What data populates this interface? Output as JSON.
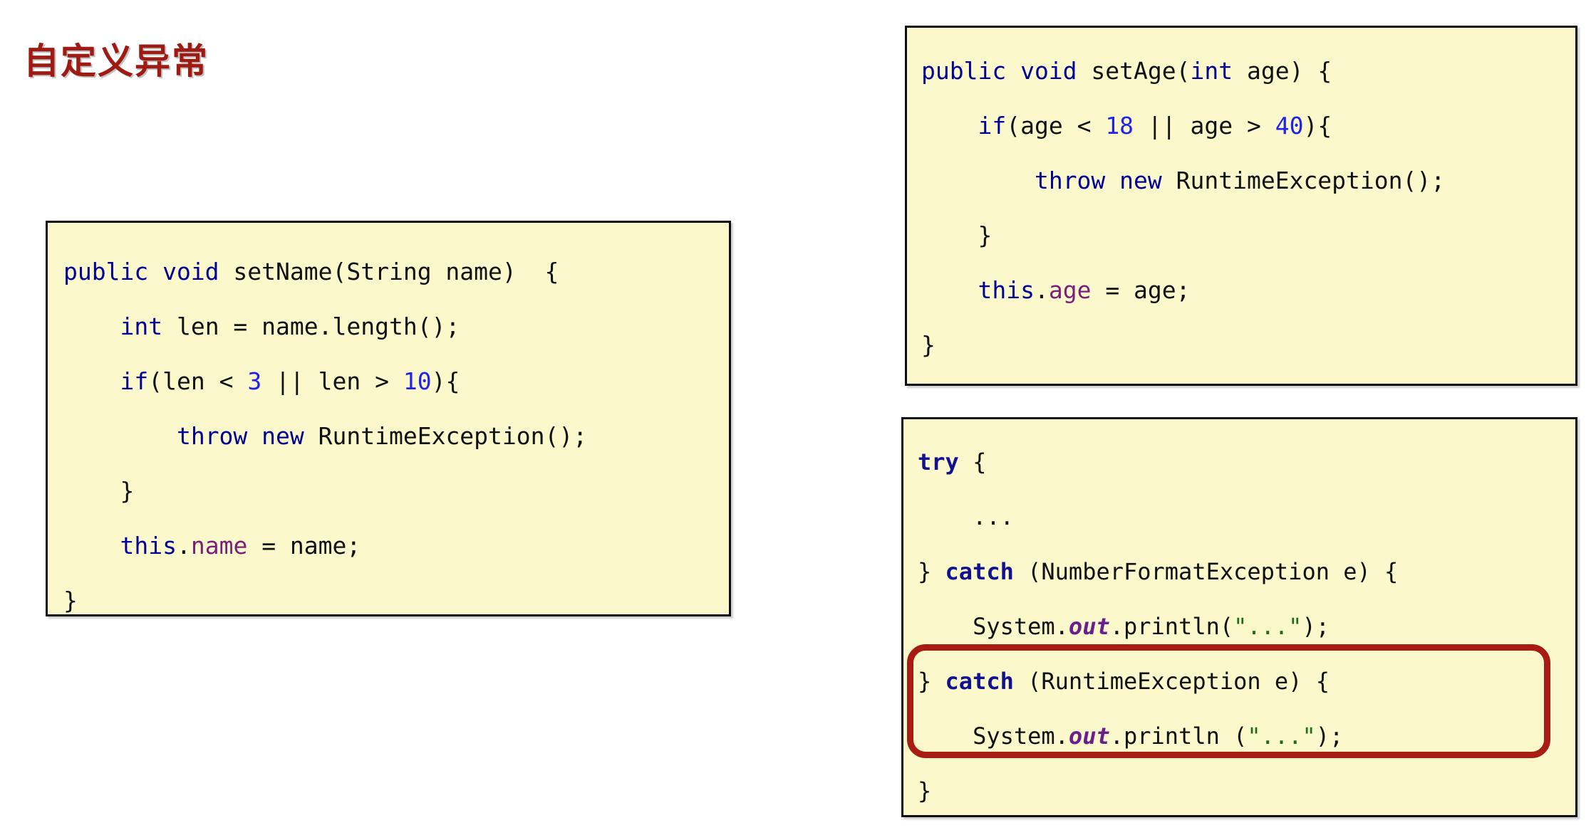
{
  "slide": {
    "title": "自定义异常",
    "title_color": "#9e1b14",
    "background_color": "#ffffff"
  },
  "palette": {
    "code_background": "#fbf8cc",
    "code_border": "#0e0e0e",
    "keyword": "#000099",
    "number": "#2222ee",
    "field": "#7a1f7a",
    "string": "#1d6b1d",
    "plain": "#111111",
    "highlight_ring": "#a81d13"
  },
  "code_blocks": [
    {
      "id": "set-name",
      "language": "java",
      "lines": [
        "public void setName(String name)  {",
        "    int len = name.length();",
        "    if(len < 3 || len > 10){",
        "        throw new RuntimeException();",
        "    }",
        "    this.name = name;",
        "}"
      ],
      "tokens": [
        [
          {
            "t": "public void ",
            "c": "kw"
          },
          {
            "t": "setName(String name)  {",
            "c": "pln"
          }
        ],
        [
          {
            "t": "    ",
            "c": "pln"
          },
          {
            "t": "int",
            "c": "kw"
          },
          {
            "t": " len = name.length();",
            "c": "pln"
          }
        ],
        [
          {
            "t": "    ",
            "c": "pln"
          },
          {
            "t": "if",
            "c": "kw"
          },
          {
            "t": "(len < ",
            "c": "pln"
          },
          {
            "t": "3",
            "c": "num"
          },
          {
            "t": " || len > ",
            "c": "pln"
          },
          {
            "t": "10",
            "c": "num"
          },
          {
            "t": "){",
            "c": "pln"
          }
        ],
        [
          {
            "t": "        ",
            "c": "pln"
          },
          {
            "t": "throw new",
            "c": "kw"
          },
          {
            "t": " RuntimeException();",
            "c": "pln"
          }
        ],
        [
          {
            "t": "    }",
            "c": "pln"
          }
        ],
        [
          {
            "t": "    ",
            "c": "pln"
          },
          {
            "t": "this",
            "c": "kw"
          },
          {
            "t": ".",
            "c": "pln"
          },
          {
            "t": "name",
            "c": "fld"
          },
          {
            "t": " = name;",
            "c": "pln"
          }
        ],
        [
          {
            "t": "}",
            "c": "pln"
          }
        ]
      ]
    },
    {
      "id": "set-age",
      "language": "java",
      "lines": [
        "public void setAge(int age) {",
        "    if(age < 18 || age > 40){",
        "        throw new RuntimeException();",
        "    }",
        "    this.age = age;",
        "}"
      ],
      "tokens": [
        [
          {
            "t": "public void ",
            "c": "kw"
          },
          {
            "t": "setAge(",
            "c": "pln"
          },
          {
            "t": "int",
            "c": "kw"
          },
          {
            "t": " age) {",
            "c": "pln"
          }
        ],
        [
          {
            "t": "    ",
            "c": "pln"
          },
          {
            "t": "if",
            "c": "kw"
          },
          {
            "t": "(age < ",
            "c": "pln"
          },
          {
            "t": "18",
            "c": "num"
          },
          {
            "t": " || age > ",
            "c": "pln"
          },
          {
            "t": "40",
            "c": "num"
          },
          {
            "t": "){",
            "c": "pln"
          }
        ],
        [
          {
            "t": "        ",
            "c": "pln"
          },
          {
            "t": "throw new",
            "c": "kw"
          },
          {
            "t": " RuntimeException();",
            "c": "pln"
          }
        ],
        [
          {
            "t": "    }",
            "c": "pln"
          }
        ],
        [
          {
            "t": "    ",
            "c": "pln"
          },
          {
            "t": "this",
            "c": "kw"
          },
          {
            "t": ".",
            "c": "pln"
          },
          {
            "t": "age",
            "c": "fld"
          },
          {
            "t": " = age;",
            "c": "pln"
          }
        ],
        [
          {
            "t": "}",
            "c": "pln"
          }
        ]
      ]
    },
    {
      "id": "try-catch",
      "language": "java",
      "lines": [
        "try {",
        "    ...",
        "} catch (NumberFormatException e) {",
        "    System.out.println(\"...\");",
        "} catch (RuntimeException e) {",
        "    System.out.println (\"...\");",
        "}"
      ],
      "tokens": [
        [
          {
            "t": "try",
            "c": "kwb"
          },
          {
            "t": " {",
            "c": "pln"
          }
        ],
        [
          {
            "t": "    ...",
            "c": "pln"
          }
        ],
        [
          {
            "t": "} ",
            "c": "pln"
          },
          {
            "t": "catch",
            "c": "kwb"
          },
          {
            "t": " (NumberFormatException e) {",
            "c": "pln"
          }
        ],
        [
          {
            "t": "    System.",
            "c": "pln"
          },
          {
            "t": "out",
            "c": "fldbi"
          },
          {
            "t": ".println(",
            "c": "pln"
          },
          {
            "t": "\"...\"",
            "c": "str"
          },
          {
            "t": ");",
            "c": "pln"
          }
        ],
        [
          {
            "t": "} ",
            "c": "pln"
          },
          {
            "t": "catch",
            "c": "kwb"
          },
          {
            "t": " (RuntimeException e) {",
            "c": "pln"
          }
        ],
        [
          {
            "t": "    System.",
            "c": "pln"
          },
          {
            "t": "out",
            "c": "fldbi"
          },
          {
            "t": ".println (",
            "c": "pln"
          },
          {
            "t": "\"...\"",
            "c": "str"
          },
          {
            "t": ");",
            "c": "pln"
          }
        ],
        [
          {
            "t": "}",
            "c": "pln"
          }
        ]
      ],
      "highlight": {
        "shape": "rounded-rectangle",
        "color": "#a81d13",
        "covers_lines": [
          4,
          5
        ]
      }
    }
  ]
}
